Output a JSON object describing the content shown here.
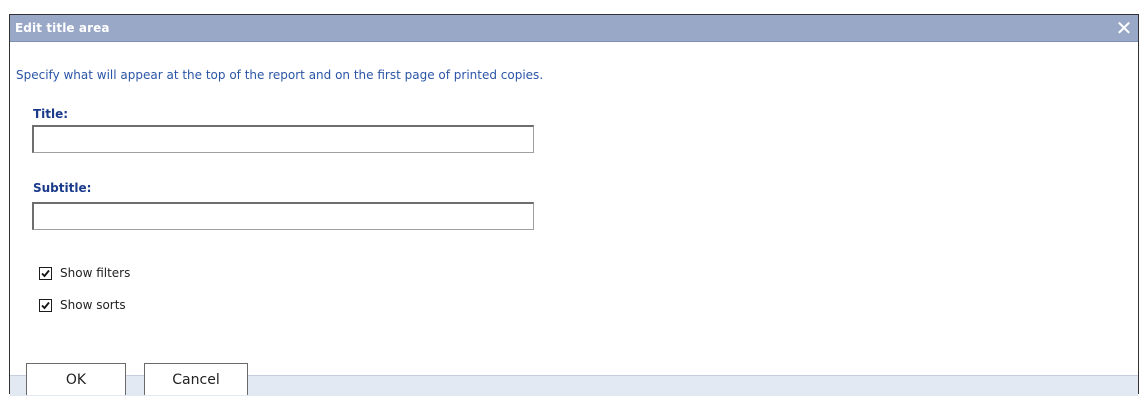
{
  "dialog": {
    "title": "Edit title area",
    "close_icon": "close-icon",
    "description": "Specify what will appear at the top of the report and on the first page of printed copies."
  },
  "fields": {
    "title_label": "Title:",
    "title_value": "",
    "subtitle_label": "Subtitle:",
    "subtitle_value": ""
  },
  "options": [
    {
      "label": "Show filters",
      "checked": true
    },
    {
      "label": "Show sorts",
      "checked": true
    }
  ],
  "buttons": {
    "ok_label": "OK",
    "cancel_label": "Cancel"
  },
  "colors": {
    "titlebar": "#9aa8c8",
    "description_text": "#2b55a6",
    "label_text": "#1a3a8a",
    "footer": "#e3e9f3"
  }
}
